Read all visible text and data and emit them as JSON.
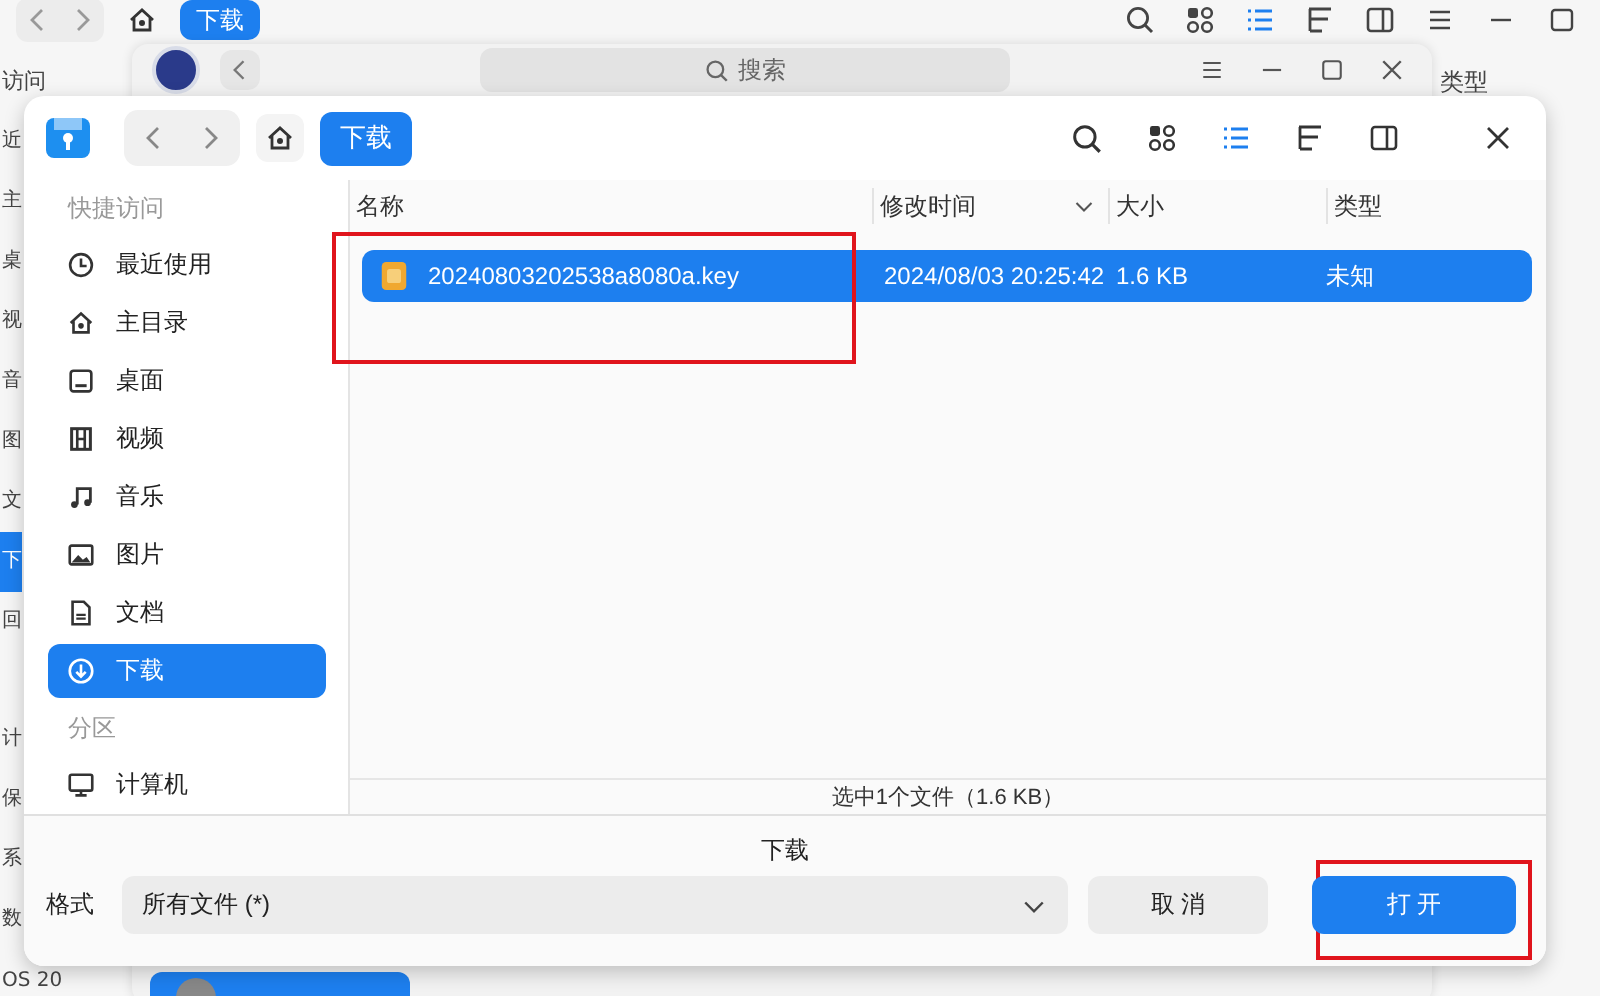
{
  "background": {
    "top_window": {
      "location": "下载",
      "side_labels": [
        {
          "label": "访问",
          "selected": false
        },
        {
          "label": "近",
          "selected": false
        },
        {
          "label": "主",
          "selected": false
        },
        {
          "label": "桌",
          "selected": false
        },
        {
          "label": "视",
          "selected": false
        },
        {
          "label": "音",
          "selected": false
        },
        {
          "label": "图",
          "selected": false
        },
        {
          "label": "文",
          "selected": false
        },
        {
          "label": "下",
          "selected": true
        },
        {
          "label": "回",
          "selected": false
        },
        {
          "label": "计",
          "selected": false
        },
        {
          "label": "保",
          "selected": false
        },
        {
          "label": "系",
          "selected": false
        },
        {
          "label": "数",
          "selected": false
        },
        {
          "label": "OS 20",
          "selected": false
        }
      ],
      "column_label": "类型"
    },
    "middle_window": {
      "search": {
        "placeholder": "搜索"
      }
    }
  },
  "dialog": {
    "location": "下载",
    "view_modes": [
      {
        "kind": "icons",
        "selected": false
      },
      {
        "kind": "list",
        "selected": true
      },
      {
        "kind": "tree",
        "selected": false
      }
    ],
    "sidebar": [
      {
        "kind": "heading",
        "label": "快捷访问"
      },
      {
        "kind": "recent",
        "label": "最近使用",
        "selected": false
      },
      {
        "kind": "home",
        "label": "主目录",
        "selected": false
      },
      {
        "kind": "desktop",
        "label": "桌面",
        "selected": false
      },
      {
        "kind": "videos",
        "label": "视频",
        "selected": false
      },
      {
        "kind": "music",
        "label": "音乐",
        "selected": false
      },
      {
        "kind": "pictures",
        "label": "图片",
        "selected": false
      },
      {
        "kind": "documents",
        "label": "文档",
        "selected": false
      },
      {
        "kind": "downloads",
        "label": "下载",
        "selected": true
      },
      {
        "kind": "heading",
        "label": "分区"
      },
      {
        "kind": "computer",
        "label": "计算机",
        "selected": false
      }
    ],
    "table": {
      "columns": [
        {
          "label": "名称",
          "sorted": false
        },
        {
          "label": "修改时间",
          "sorted": true
        },
        {
          "label": "大小",
          "sorted": false
        },
        {
          "label": "类型",
          "sorted": false
        }
      ],
      "rows": [
        {
          "name": "20240803202538a8080a.key",
          "modified": "2024/08/03 20:25:42",
          "size": "1.6 KB",
          "type": "未知",
          "selected": true,
          "highlighted": true
        }
      ]
    },
    "status_bar": "选中1个文件（1.6 KB）",
    "footer": {
      "title": "下载",
      "format_label": "格式",
      "format": "所有文件 (*)",
      "buttons": [
        {
          "label": "取 消",
          "kind": "secondary",
          "highlighted": false
        },
        {
          "label": "打 开",
          "kind": "primary",
          "highlighted": true
        }
      ]
    }
  }
}
